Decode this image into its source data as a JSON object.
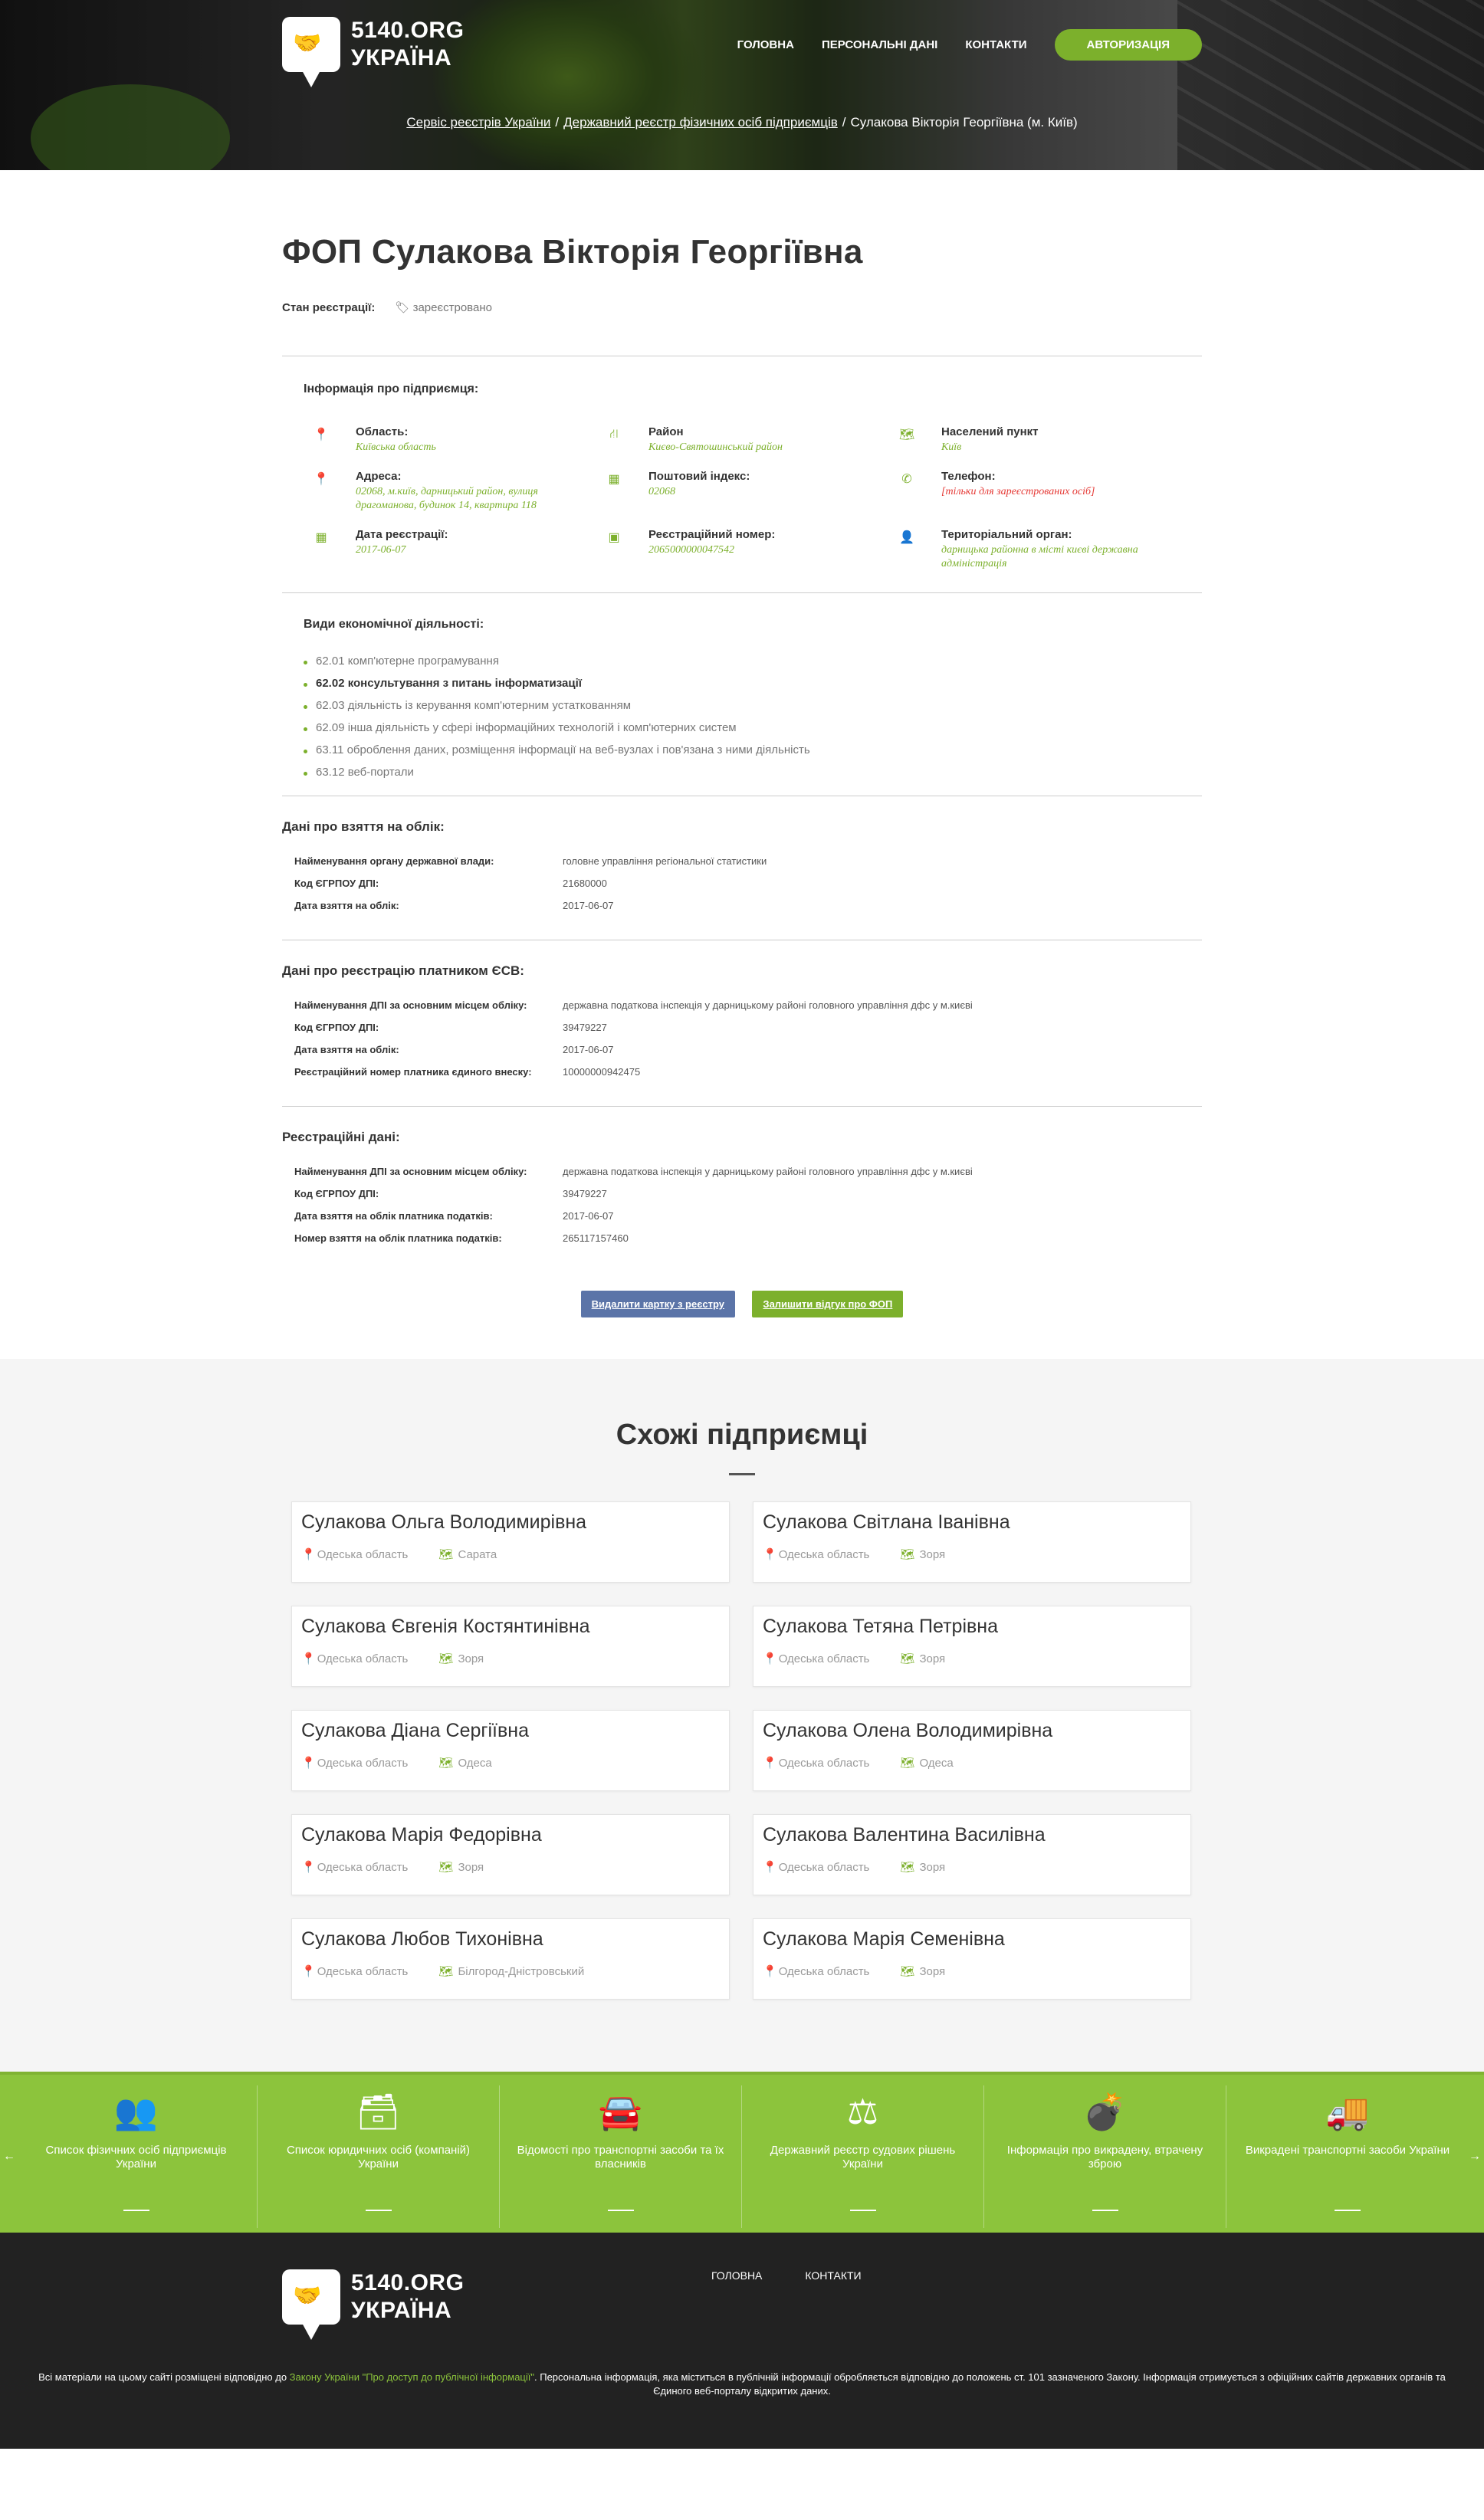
{
  "header": {
    "logo_line1": "5140.ORG",
    "logo_line2": "УКРАЇНА",
    "nav": [
      "ГОЛОВНА",
      "ПЕРСОНАЛЬНІ ДАНІ",
      "КОНТАКТИ"
    ],
    "auth_label": "АВТОРИЗАЦІЯ",
    "breadcrumbs": [
      "Сервіс реєстрів України",
      "Державний реєстр фізичних осіб підприємців",
      "Сулакова Вікторія Георгіївна (м. Київ)"
    ]
  },
  "main": {
    "title": "ФОП Сулакова Вікторія Георгіївна",
    "status_label": "Стан реєстрації:",
    "status_value": "зареєстровано",
    "info_title": "Інформація про підприємця:",
    "info": [
      {
        "icon": "pin-icon",
        "label": "Область:",
        "value": "Київська область"
      },
      {
        "icon": "signpost-icon",
        "label": "Район",
        "value": "Києво-Святошинський район"
      },
      {
        "icon": "map-icon",
        "label": "Населений пункт",
        "value": "Київ"
      },
      {
        "icon": "pin-icon",
        "label": "Адреса:",
        "value": "02068, м.київ, дарницький район, вулиця драгоманова, будинок 14, квартира 118"
      },
      {
        "icon": "calendar-icon",
        "label": "Поштовий індекс:",
        "value": "02068"
      },
      {
        "icon": "phone-icon",
        "label": "Телефон:",
        "value": "[тільки для зареєстрованих осіб]"
      },
      {
        "icon": "calendar-icon",
        "label": "Дата реєстрації:",
        "value": "2017-06-07"
      },
      {
        "icon": "grid-icon",
        "label": "Реєстраційний номер:",
        "value": "2065000000047542"
      },
      {
        "icon": "user-icon",
        "label": "Територіальний орган:",
        "value": "дарницька районна в місті києві державна адміністрація"
      }
    ],
    "kved_title": "Види економічної діяльності:",
    "kved": [
      "62.01 комп'ютерне програмування",
      "62.02 консультування з питань інформатизації",
      "62.03 діяльність із керування комп'ютерним устаткованням",
      "62.09 інша діяльність у сфері інформаційних технологій і комп'ютерних систем",
      "63.11 оброблення даних, розміщення інформації на веб-вузлах і пов'язана з ними діяльність",
      "63.12 веб-портали"
    ],
    "stat_title": "Дані про взяття на облік:",
    "stat_rows": [
      {
        "k": "Найменування органу державної влади:",
        "v": "головне управління регіональної статистики"
      },
      {
        "k": "Код ЄГРПОУ ДПІ:",
        "v": "21680000"
      },
      {
        "k": "Дата взяття на облік:",
        "v": "2017-06-07"
      }
    ],
    "esv_title": "Дані про реєстрацію платником ЄСВ:",
    "esv_rows": [
      {
        "k": "Найменування ДПІ за основним місцем обліку:",
        "v": "державна податкова інспекція у дарницькому районі головного управління дфс у м.києві"
      },
      {
        "k": "Код ЄГРПОУ ДПІ:",
        "v": "39479227"
      },
      {
        "k": "Дата взяття на облік:",
        "v": "2017-06-07"
      },
      {
        "k": "Реєстраційний номер платника єдиного внеску:",
        "v": "10000000942475"
      }
    ],
    "reg_title": "Реєстраційні дані:",
    "reg_rows": [
      {
        "k": "Найменування ДПІ за основним місцем обліку:",
        "v": "державна податкова інспекція у дарницькому районі головного управління дфс у м.києві"
      },
      {
        "k": "Код ЄГРПОУ ДПІ:",
        "v": "39479227"
      },
      {
        "k": "Дата взяття на облік платника податків:",
        "v": "2017-06-07"
      },
      {
        "k": "Номер взяття на облік платника податків:",
        "v": "265117157460"
      }
    ],
    "btn_delete": "Видалити картку з реєстру",
    "btn_review": "Залишити відгук про ФОП"
  },
  "similar": {
    "title": "Схожі підприємці",
    "items": [
      {
        "name": "Сулакова Ольга Володимирівна",
        "region": "Одеська область",
        "city": "Сарата"
      },
      {
        "name": "Сулакова Світлана Іванівна",
        "region": "Одеська область",
        "city": "Зоря"
      },
      {
        "name": "Сулакова Євгенія Костянтинівна",
        "region": "Одеська область",
        "city": "Зоря"
      },
      {
        "name": "Сулакова Тетяна Петрівна",
        "region": "Одеська область",
        "city": "Зоря"
      },
      {
        "name": "Сулакова Діана Сергіївна",
        "region": "Одеська область",
        "city": "Одеса"
      },
      {
        "name": "Сулакова Олена Володимирівна",
        "region": "Одеська область",
        "city": "Одеса"
      },
      {
        "name": "Сулакова Марія Федорівна",
        "region": "Одеська область",
        "city": "Зоря"
      },
      {
        "name": "Сулакова Валентина Василівна",
        "region": "Одеська область",
        "city": "Зоря"
      },
      {
        "name": "Сулакова Любов Тихонівна",
        "region": "Одеська область",
        "city": "Білгород-Дністровський"
      },
      {
        "name": "Сулакова Марія Семенівна",
        "region": "Одеська область",
        "city": "Зоря"
      }
    ]
  },
  "band": {
    "items": [
      {
        "icon": "people-icon",
        "glyph": "👥",
        "text": "Список фізичних осіб підприємців України"
      },
      {
        "icon": "archive-icon",
        "glyph": "🗃",
        "text": "Список юридичних осіб (компаній) України"
      },
      {
        "icon": "car-icon",
        "glyph": "🚘",
        "text": "Відомості про транспортні засоби та їх власників"
      },
      {
        "icon": "scales-icon",
        "glyph": "⚖",
        "text": "Державний реєстр судових рішень України"
      },
      {
        "icon": "bomb-icon",
        "glyph": "💣",
        "text": "Інформація про викрадену, втрачену зброю"
      },
      {
        "icon": "truck-icon",
        "glyph": "🚚",
        "text": "Викрадені транспортні засоби України"
      }
    ]
  },
  "footer": {
    "logo_line1": "5140.ORG",
    "logo_line2": "УКРАЇНА",
    "nav": [
      "ГОЛОВНА",
      "КОНТАКТИ"
    ],
    "note_before": "Всі матеріали на цьому сайті розміщені відповідно до ",
    "note_link": "Закону України \"Про доступ до публічної інформації\"",
    "note_after": ". Персональна інформація, яка міститься в публічній інформації обробляється відповідно до положень ст. 101 зазначеного Закону. Інформація отримується з офіційних сайтів державних органів та Єдиного веб-порталу відкритих даних."
  },
  "colors": {
    "accent": "#7cb02c",
    "band": "#8cc43c",
    "button_blue": "#5b74a8",
    "error": "#e53935"
  }
}
